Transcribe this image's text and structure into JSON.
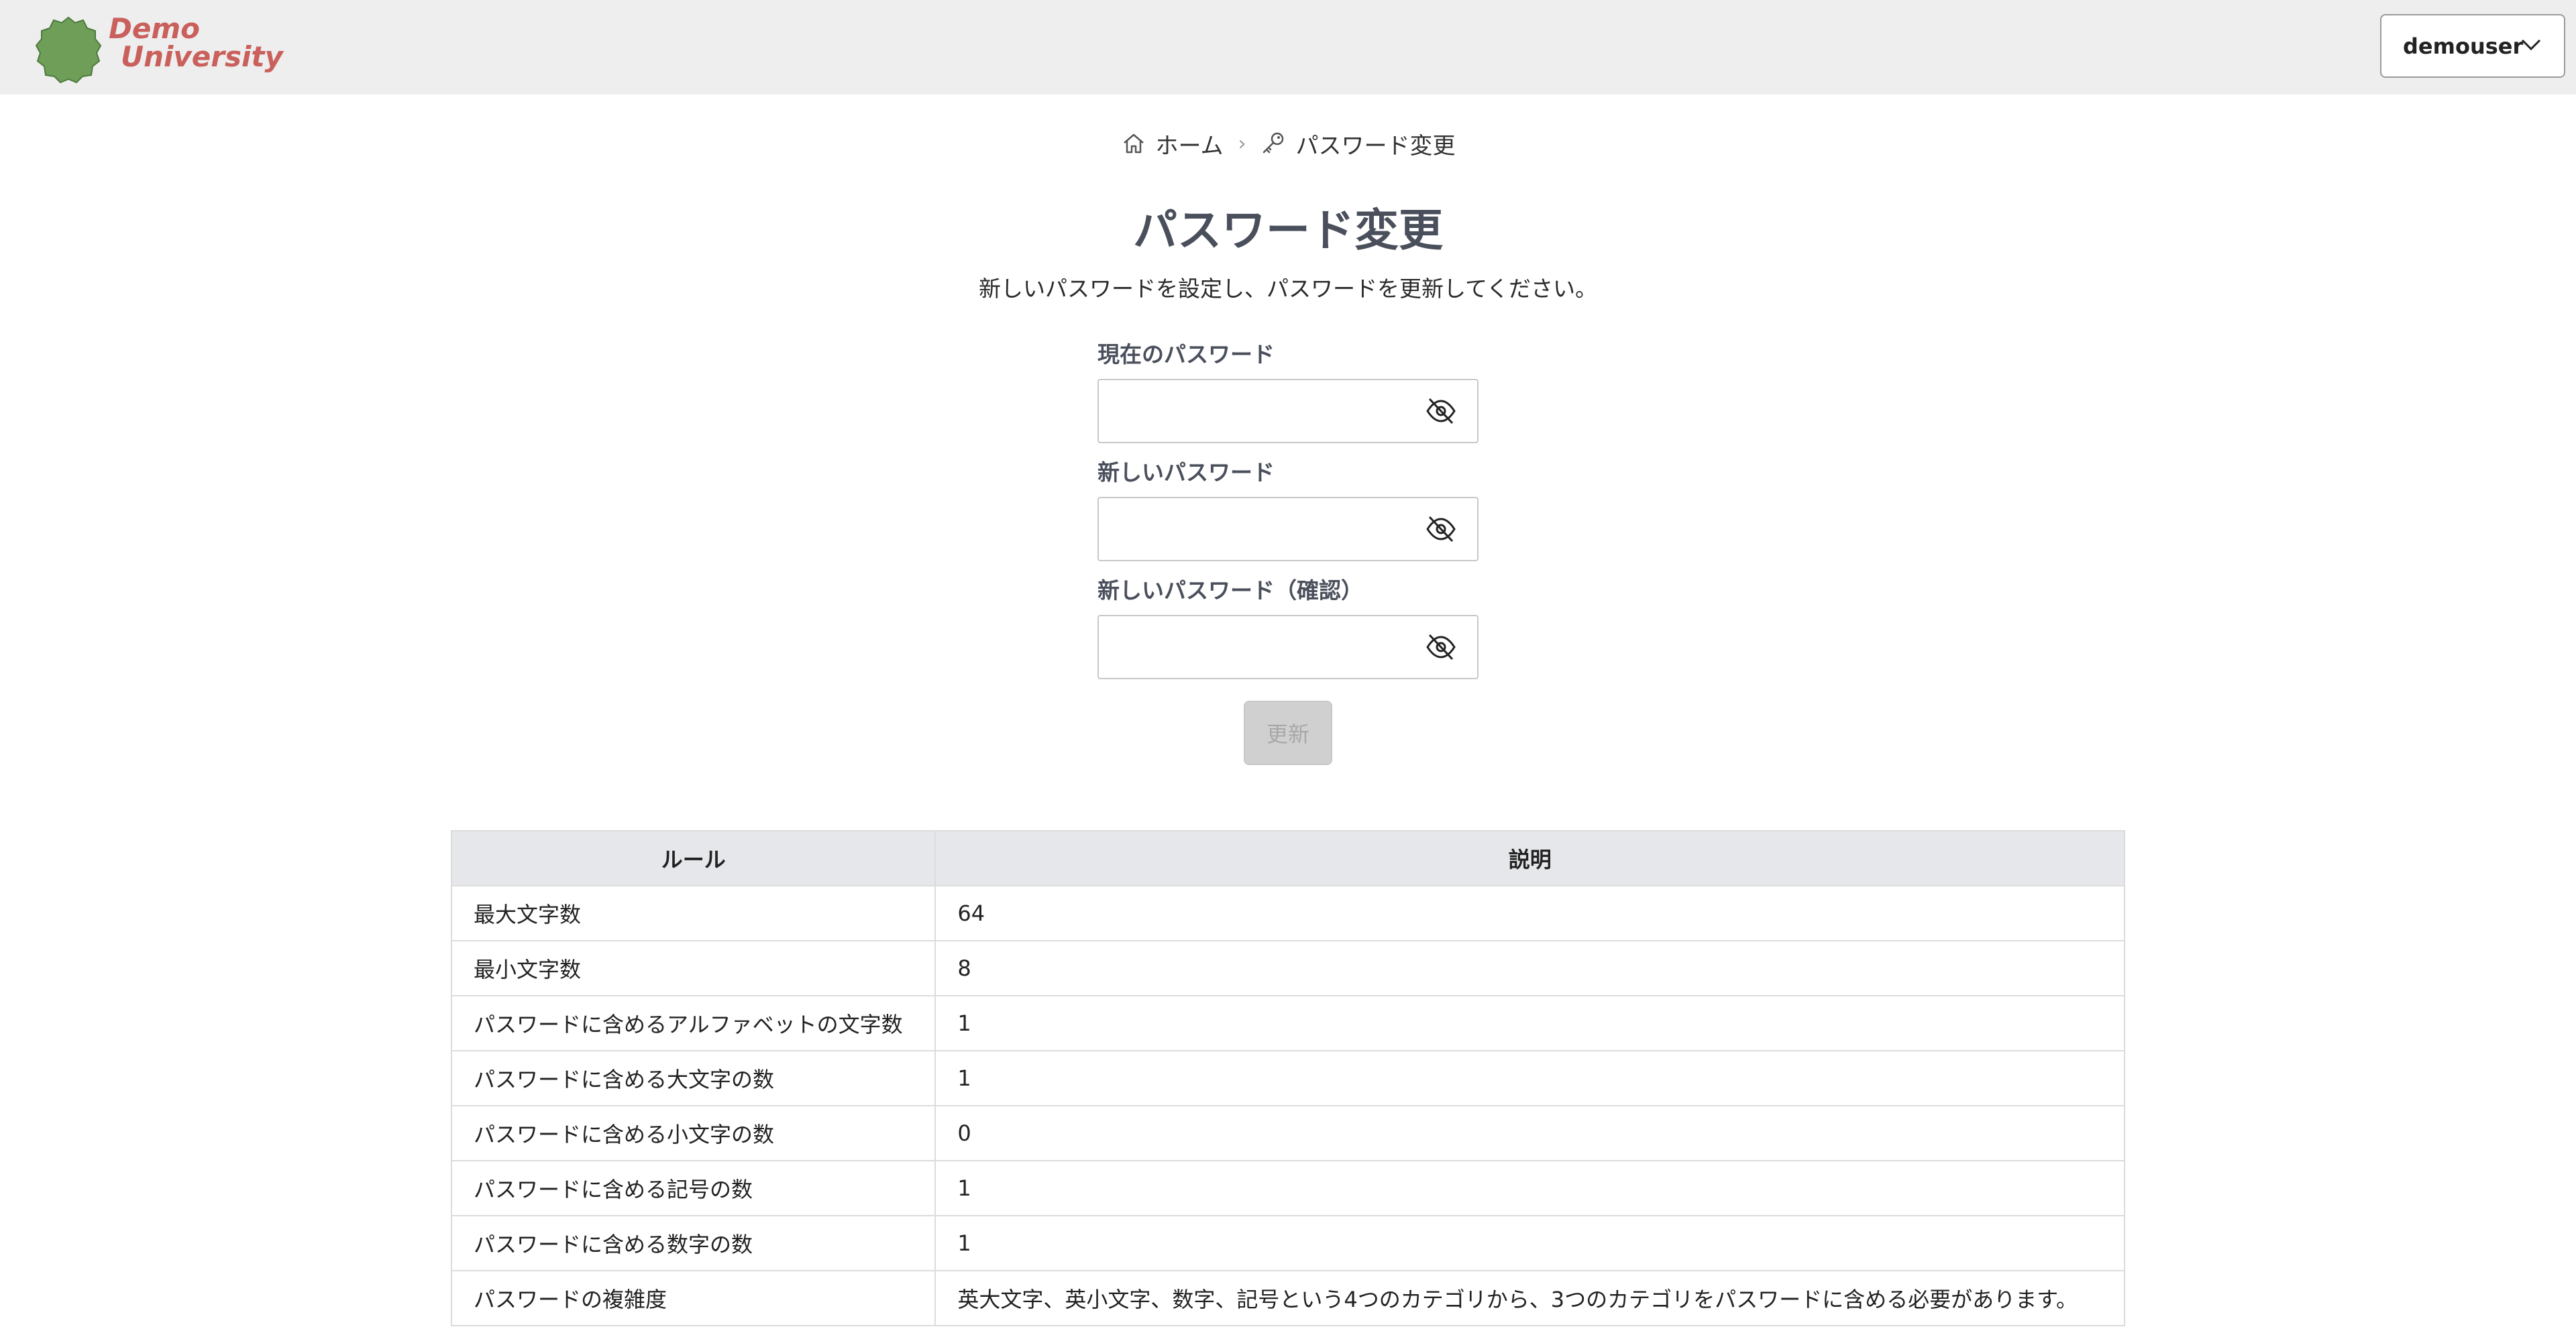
{
  "brand": {
    "line1": "Demo",
    "line2": "University",
    "logo_color": "#c9605c",
    "badge_color": "#6e9e58"
  },
  "header": {
    "user_menu_label": "demouser"
  },
  "breadcrumb": {
    "home_label": "ホーム",
    "current_label": "パスワード変更",
    "separator": "›"
  },
  "page": {
    "title": "パスワード変更",
    "subtitle": "新しいパスワードを設定し、パスワードを更新してください。"
  },
  "form": {
    "current_password": {
      "label": "現在のパスワード",
      "value": ""
    },
    "new_password": {
      "label": "新しいパスワード",
      "value": ""
    },
    "confirm_password": {
      "label": "新しいパスワード（確認）",
      "value": ""
    },
    "submit_label": "更新",
    "submit_disabled": true
  },
  "rules_table": {
    "headers": [
      "ルール",
      "説明"
    ],
    "rows": [
      {
        "rule": "最大文字数",
        "desc": "64"
      },
      {
        "rule": "最小文字数",
        "desc": "8"
      },
      {
        "rule": "パスワードに含めるアルファベットの文字数",
        "desc": "1"
      },
      {
        "rule": "パスワードに含める大文字の数",
        "desc": "1"
      },
      {
        "rule": "パスワードに含める小文字の数",
        "desc": "0"
      },
      {
        "rule": "パスワードに含める記号の数",
        "desc": "1"
      },
      {
        "rule": "パスワードに含める数字の数",
        "desc": "1"
      },
      {
        "rule": "パスワードの複雑度",
        "desc": "英大文字、英小文字、数字、記号という4つのカテゴリから、3つのカテゴリをパスワードに含める必要があります。"
      }
    ]
  }
}
